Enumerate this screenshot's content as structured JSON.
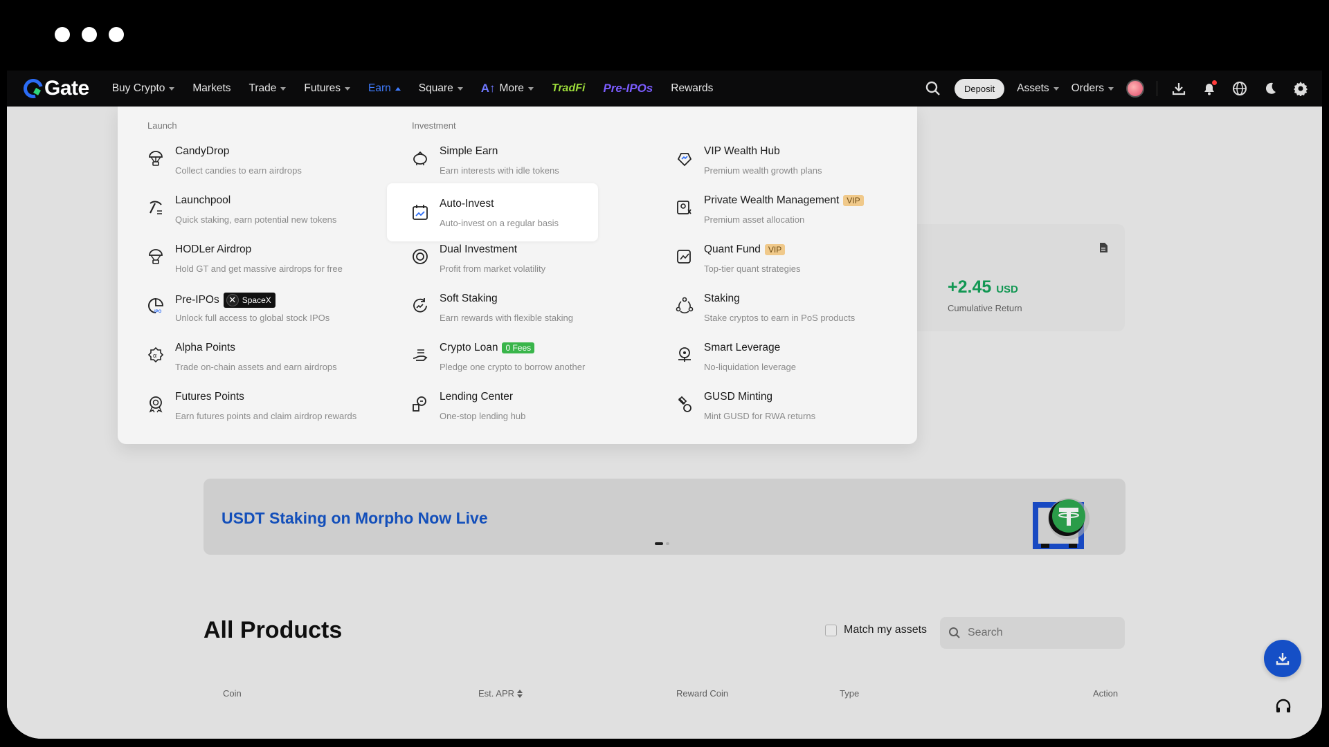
{
  "brand": {
    "name": "Gate",
    "colors": {
      "accent": "#3f7cff",
      "positive": "#14a35a",
      "navbar": "#0b0b0c"
    }
  },
  "nav": {
    "items": [
      {
        "label": "Buy Crypto",
        "caret": true
      },
      {
        "label": "Markets",
        "caret": false
      },
      {
        "label": "Trade",
        "caret": true
      },
      {
        "label": "Futures",
        "caret": true
      },
      {
        "label": "Earn",
        "caret": true,
        "active": true
      },
      {
        "label": "Square",
        "caret": true
      },
      {
        "label": "More",
        "caret": true
      },
      {
        "label": "TradFi",
        "style": "tradfi"
      },
      {
        "label": "Pre-IPOs",
        "style": "preipo"
      },
      {
        "label": "Rewards",
        "caret": false
      }
    ],
    "deposit_label": "Deposit",
    "assets_label": "Assets",
    "orders_label": "Orders",
    "icons": [
      "search-icon",
      "download-icon",
      "bell-icon",
      "globe-icon",
      "moon-icon",
      "gear-icon"
    ]
  },
  "dropdown": {
    "launch": {
      "title": "Launch",
      "items": [
        {
          "title": "CandyDrop",
          "desc": "Collect candies to earn airdrops",
          "icon": "candy-parachute-icon"
        },
        {
          "title": "Launchpool",
          "desc": "Quick staking, earn potential new tokens",
          "icon": "pickaxe-icon"
        },
        {
          "title": "HODLer Airdrop",
          "desc": "Hold GT and get massive airdrops for free",
          "icon": "parachute-icon"
        },
        {
          "title": "Pre-IPOs",
          "desc": "Unlock full access to global stock IPOs",
          "icon": "ipo-icon",
          "badge": "SpaceX"
        },
        {
          "title": "Alpha Points",
          "desc": "Trade on-chain assets and earn airdrops",
          "icon": "alpha-gear-icon"
        },
        {
          "title": "Futures Points",
          "desc": "Earn futures points and claim airdrop rewards",
          "icon": "medal-icon"
        }
      ]
    },
    "investment": {
      "title": "Investment",
      "items": [
        {
          "title": "Simple Earn",
          "desc": "Earn interests with idle tokens",
          "icon": "piggy-bank-icon"
        },
        {
          "title": "Auto-Invest",
          "desc": "Auto-invest on a regular basis",
          "icon": "calendar-chart-icon",
          "highlight": true
        },
        {
          "title": "Dual Investment",
          "desc": "Profit from market volatility",
          "icon": "dual-circle-icon"
        },
        {
          "title": "Soft Staking",
          "desc": "Earn rewards with flexible staking",
          "icon": "staking-cycle-icon"
        },
        {
          "title": "Crypto Loan",
          "desc": "Pledge one crypto to borrow another",
          "icon": "hand-coin-icon",
          "badge": "0 Fees"
        },
        {
          "title": "Lending Center",
          "desc": "One-stop lending hub",
          "icon": "lending-icon"
        }
      ]
    },
    "wealth": {
      "items": [
        {
          "title": "VIP Wealth Hub",
          "desc": "Premium wealth growth plans",
          "icon": "diamond-chart-icon"
        },
        {
          "title": "Private Wealth Management",
          "desc": "Premium asset allocation",
          "icon": "private-user-icon",
          "badge": "VIP"
        },
        {
          "title": "Quant Fund",
          "desc": "Top-tier quant strategies",
          "icon": "quant-chart-icon",
          "badge": "VIP"
        },
        {
          "title": "Staking",
          "desc": "Stake cryptos to earn in PoS products",
          "icon": "network-nodes-icon"
        },
        {
          "title": "Smart Leverage",
          "desc": "No-liquidation leverage",
          "icon": "lever-icon"
        },
        {
          "title": "GUSD Minting",
          "desc": "Mint GUSD for RWA returns",
          "icon": "mint-icon"
        }
      ]
    }
  },
  "page": {
    "return_value": "+2.45",
    "return_unit": "USD",
    "return_label": "Cumulative Return",
    "banner_title": "USDT Staking on Morpho Now Live",
    "all_products_title": "All Products",
    "match_assets_label": "Match my assets",
    "search_placeholder": "Search",
    "table_headers": [
      "Coin",
      "Est. APR",
      "Reward Coin",
      "Type",
      "Action"
    ]
  }
}
